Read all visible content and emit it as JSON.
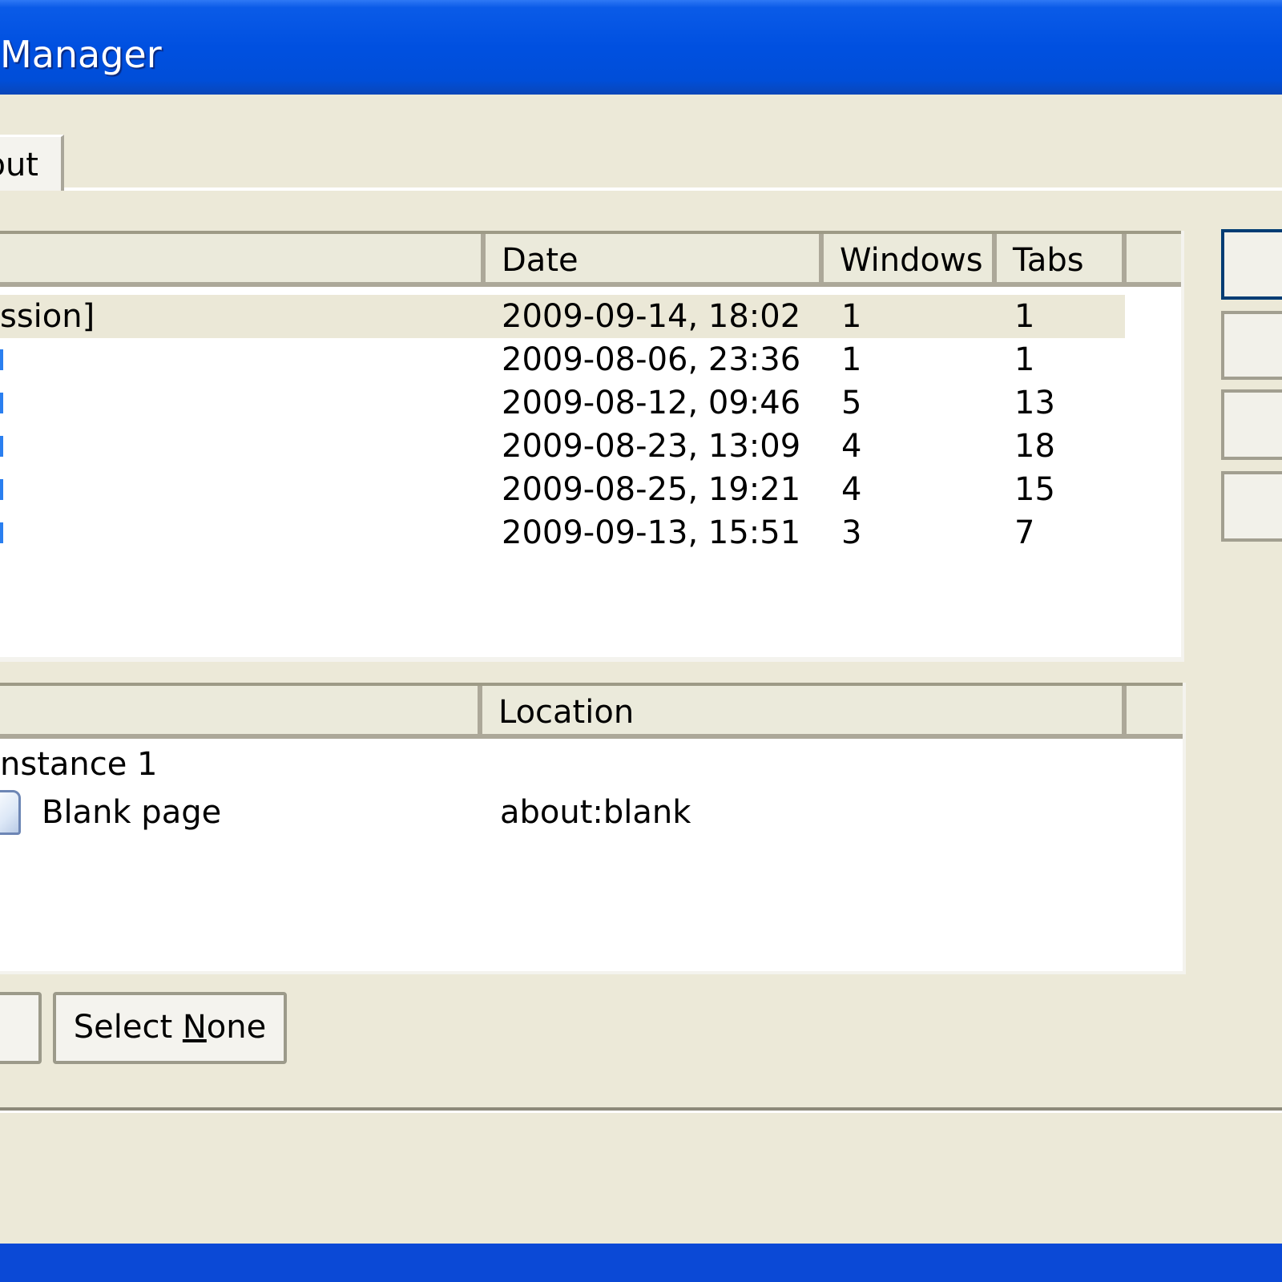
{
  "window": {
    "title": "Manager"
  },
  "tabs": [
    {
      "label": "out"
    }
  ],
  "sessions": {
    "columns": [
      "Date",
      "Windows",
      "Tabs"
    ],
    "rows": [
      {
        "name": "ssion]",
        "date": "2009-09-14, 18:02",
        "windows": "1",
        "tabs": "1"
      },
      {
        "name": "",
        "date": "2009-08-06, 23:36",
        "windows": "1",
        "tabs": "1"
      },
      {
        "name": "",
        "date": "2009-08-12, 09:46",
        "windows": "5",
        "tabs": "13"
      },
      {
        "name": "",
        "date": "2009-08-23, 13:09",
        "windows": "4",
        "tabs": "18"
      },
      {
        "name": "",
        "date": "2009-08-25, 19:21",
        "windows": "4",
        "tabs": "15"
      },
      {
        "name": "",
        "date": "2009-09-13, 15:51",
        "windows": "3",
        "tabs": "7"
      }
    ]
  },
  "details": {
    "columns": [
      "Location"
    ],
    "group": "nstance 1",
    "items": [
      {
        "title": "Blank page",
        "location": "about:blank",
        "icon": "page-icon"
      }
    ]
  },
  "buttons": {
    "select_none_pre": "Select ",
    "select_none_key": "N",
    "select_none_post": "one"
  },
  "colors": {
    "title_bar": "#0055e5",
    "face": "#ece9d8",
    "selection": "#ebe8d7"
  }
}
